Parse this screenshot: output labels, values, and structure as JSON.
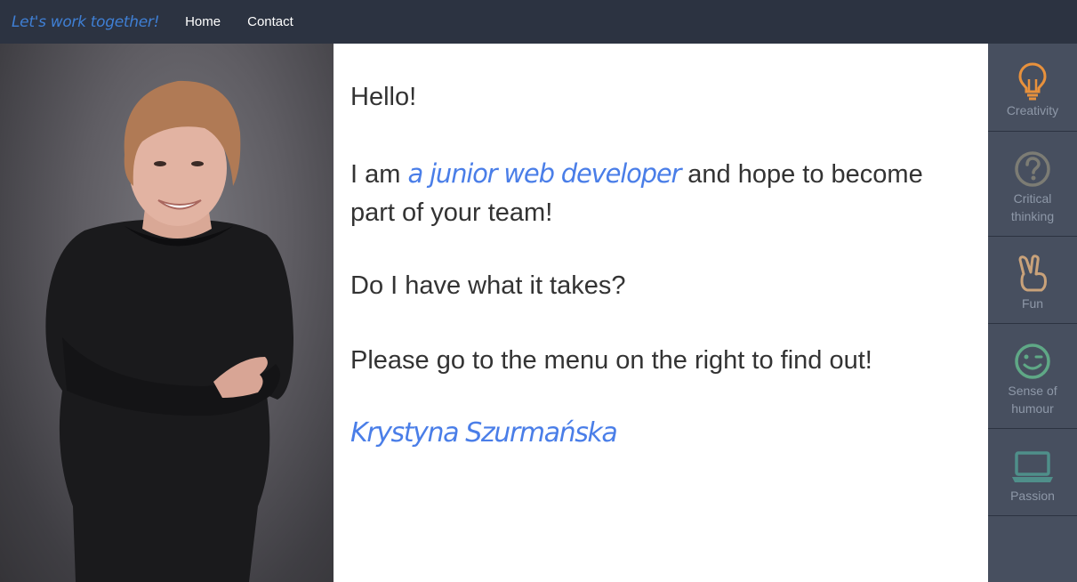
{
  "navbar": {
    "brand": "Let's work together!",
    "links": [
      "Home",
      "Contact"
    ]
  },
  "intro": {
    "hello": "Hello!",
    "iam_prefix": "I am ",
    "iam_highlight": "a junior web developer",
    "iam_suffix": " and hope to become part of your team!",
    "question": "Do I have what it takes?",
    "menu_hint": "Please go to the menu on the right to find out!",
    "signature": "Krystyna Szurmańska"
  },
  "sidebar": {
    "items": [
      {
        "label": "Creativity",
        "icon": "lightbulb-icon",
        "color": "#e8913c"
      },
      {
        "label": "Critical thinking",
        "icon": "question-circle-icon",
        "color": "#7c7c74"
      },
      {
        "label": "Fun",
        "icon": "peace-hand-icon",
        "color": "#c9a27a"
      },
      {
        "label": "Sense of humour",
        "icon": "wink-smile-icon",
        "color": "#5fa886"
      },
      {
        "label": "Passion",
        "icon": "laptop-icon",
        "color": "#4f8f8a"
      }
    ]
  },
  "colors": {
    "navbar_bg": "#2c3341",
    "sidebar_bg": "#474f5f",
    "accent": "#4a7ee8",
    "text": "#333333"
  }
}
